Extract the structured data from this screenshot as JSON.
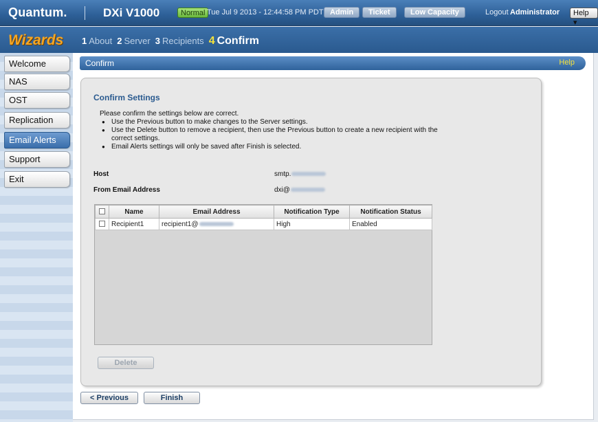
{
  "header": {
    "logo": "Quantum.",
    "product": "DXi V1000",
    "status": "Normal",
    "datetime": "Tue Jul 9 2013 - 12:44:58 PM PDT",
    "tabs": [
      "Admin",
      "Ticket",
      "Low Capacity"
    ],
    "logout": "Logout",
    "user": "Administrator",
    "help_menu": "Help ▾"
  },
  "wizard": {
    "title": "Wizards",
    "steps": [
      {
        "num": "1",
        "label": "About"
      },
      {
        "num": "2",
        "label": "Server"
      },
      {
        "num": "3",
        "label": "Recipients"
      },
      {
        "num": "4",
        "label": "Confirm"
      }
    ]
  },
  "sidebar": {
    "items": [
      {
        "label": "Welcome"
      },
      {
        "label": "NAS"
      },
      {
        "label": "OST"
      },
      {
        "label": "Replication"
      },
      {
        "label": "Email Alerts"
      },
      {
        "label": "Support"
      },
      {
        "label": "Exit"
      }
    ]
  },
  "main": {
    "header_title": "Confirm",
    "header_help": "Help",
    "panel_title": "Confirm Settings",
    "intro": "Please confirm the settings below are correct.",
    "bullets": [
      "Use the Previous button to make changes to the Server settings.",
      "Use the Delete button to remove a recipient, then use the Previous button to create a new recipient with the correct settings.",
      "Email Alerts settings will only be saved after Finish is selected."
    ],
    "host_label": "Host",
    "host_value": "smtp.",
    "from_label": "From Email Address",
    "from_value": "dxi@",
    "table": {
      "columns": [
        "Name",
        "Email Address",
        "Notification Type",
        "Notification Status"
      ],
      "rows": [
        {
          "name": "Recipient1",
          "email": "recipient1@",
          "type": "High",
          "status": "Enabled"
        }
      ]
    },
    "delete_label": "Delete",
    "previous_label": "< Previous",
    "finish_label": "Finish"
  }
}
